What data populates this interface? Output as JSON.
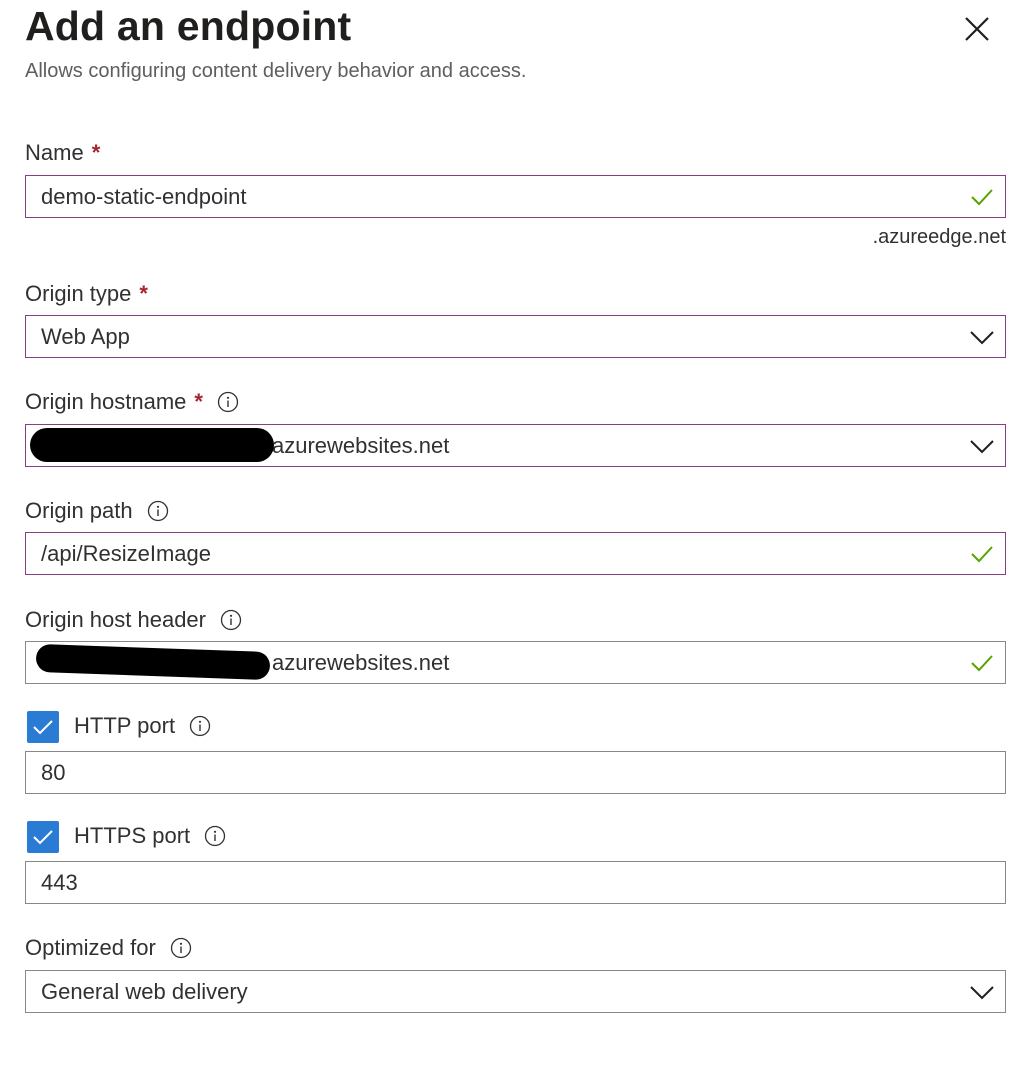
{
  "header": {
    "title": "Add an endpoint",
    "subtitle": "Allows configuring content delivery behavior and access."
  },
  "icons": {
    "close": "close-icon",
    "info": "info-icon",
    "check": "checkmark-icon",
    "chevron": "chevron-down-icon"
  },
  "colors": {
    "accent": "#8a3d85",
    "required": "#a4262c",
    "valid": "#57a300",
    "checkbox": "#2a7bd3"
  },
  "form": {
    "name": {
      "label": "Name",
      "required_mark": "*",
      "value": "demo-static-endpoint",
      "suffix": ".azureedge.net",
      "valid": true
    },
    "origin_type": {
      "label": "Origin type",
      "required_mark": "*",
      "value": "Web App"
    },
    "origin_hostname": {
      "label": "Origin hostname",
      "required_mark": "*",
      "value": "azurewebsites.net"
    },
    "origin_path": {
      "label": "Origin path",
      "value": "/api/ResizeImage",
      "valid": true
    },
    "origin_host_header": {
      "label": "Origin host header",
      "value": "azurewebsites.net",
      "valid": true
    },
    "http_port": {
      "label": "HTTP port",
      "checked": true,
      "value": "80"
    },
    "https_port": {
      "label": "HTTPS port",
      "checked": true,
      "value": "443"
    },
    "optimized_for": {
      "label": "Optimized for",
      "value": "General web delivery"
    }
  }
}
